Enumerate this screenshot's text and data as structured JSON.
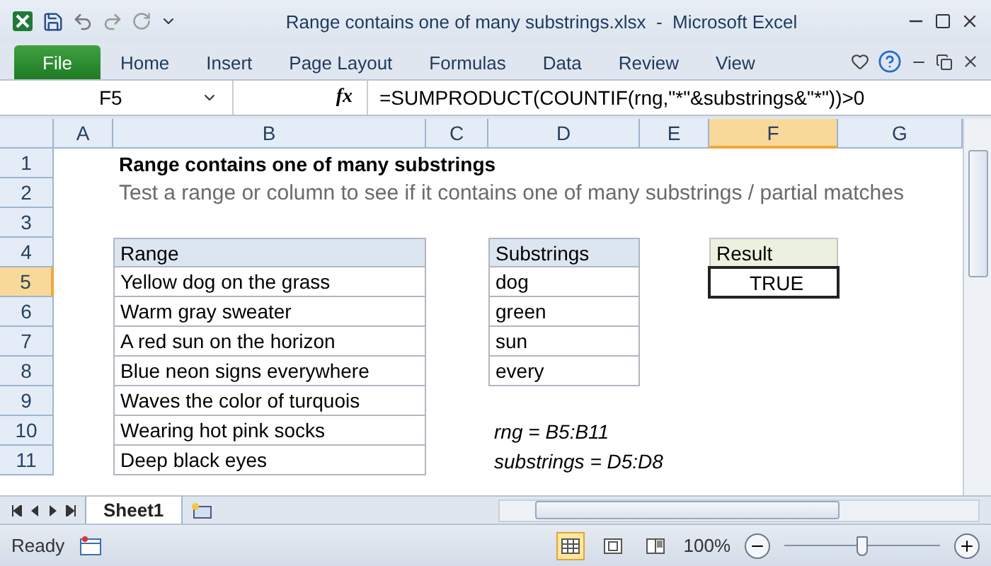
{
  "window": {
    "title": "Range contains one of many substrings.xlsx  -  Microsoft Excel"
  },
  "ribbon_tabs": [
    {
      "label": "File",
      "kind": "file"
    },
    {
      "label": "Home",
      "kind": "tab"
    },
    {
      "label": "Insert",
      "kind": "tab"
    },
    {
      "label": "Page Layout",
      "kind": "tab"
    },
    {
      "label": "Formulas",
      "kind": "tab"
    },
    {
      "label": "Data",
      "kind": "tab"
    },
    {
      "label": "Review",
      "kind": "tab"
    },
    {
      "label": "View",
      "kind": "tab"
    }
  ],
  "formula_bar": {
    "name_box": "F5",
    "fx": "fx",
    "formula": "=SUMPRODUCT(COUNTIF(rng,\"*\"&substrings&\"*\"))>0"
  },
  "columns": [
    {
      "label": "A",
      "selected": false
    },
    {
      "label": "B",
      "selected": false
    },
    {
      "label": "C",
      "selected": false
    },
    {
      "label": "D",
      "selected": false
    },
    {
      "label": "E",
      "selected": false
    },
    {
      "label": "F",
      "selected": true
    },
    {
      "label": "G",
      "selected": false
    }
  ],
  "rows": [
    {
      "number": "1",
      "selected": false,
      "b": {
        "text": "Range contains one of many substrings",
        "kind": "title"
      }
    },
    {
      "number": "2",
      "selected": false,
      "b": {
        "text": "Test a range or column to see if it contains one of many substrings / partial matches",
        "kind": "subtitle"
      }
    },
    {
      "number": "3",
      "selected": false
    },
    {
      "number": "4",
      "selected": false,
      "b": {
        "text": "Range",
        "kind": "header"
      },
      "d": {
        "text": "Substrings",
        "kind": "header"
      },
      "f": {
        "text": "Result",
        "kind": "result_header"
      }
    },
    {
      "number": "5",
      "selected": true,
      "b": {
        "text": "Yellow dog on the grass",
        "kind": "table"
      },
      "d": {
        "text": "dog",
        "kind": "table"
      },
      "f": {
        "text": "TRUE",
        "kind": "result",
        "selected": true
      }
    },
    {
      "number": "6",
      "selected": false,
      "b": {
        "text": "Warm gray sweater",
        "kind": "table"
      },
      "d": {
        "text": "green",
        "kind": "table"
      }
    },
    {
      "number": "7",
      "selected": false,
      "b": {
        "text": "A red sun on the horizon",
        "kind": "table"
      },
      "d": {
        "text": "sun",
        "kind": "table"
      }
    },
    {
      "number": "8",
      "selected": false,
      "b": {
        "text": "Blue neon signs everywhere",
        "kind": "table"
      },
      "d": {
        "text": "every",
        "kind": "table"
      }
    },
    {
      "number": "9",
      "selected": false,
      "b": {
        "text": "Waves the color of turquois",
        "kind": "table"
      }
    },
    {
      "number": "10",
      "selected": false,
      "b": {
        "text": "Wearing hot pink socks",
        "kind": "table"
      },
      "d": {
        "text": "rng = B5:B11",
        "kind": "note"
      }
    },
    {
      "number": "11",
      "selected": false,
      "b": {
        "text": "Deep black eyes",
        "kind": "table"
      },
      "d": {
        "text": "substrings = D5:D8",
        "kind": "note"
      }
    }
  ],
  "sheet_tabs": [
    {
      "label": "Sheet1",
      "selected": true
    }
  ],
  "status_bar": {
    "status": "Ready",
    "views": [
      {
        "kind": "normal",
        "selected": true
      },
      {
        "kind": "page_layout",
        "selected": false
      },
      {
        "kind": "page_break",
        "selected": false
      }
    ],
    "zoom": "100%",
    "zoom_slider": {
      "level": 0.5
    }
  }
}
